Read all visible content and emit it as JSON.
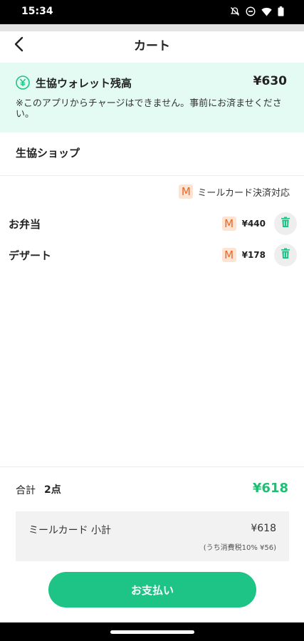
{
  "status_bar": {
    "time": "15:34",
    "icons": [
      "mute-icon",
      "do-not-disturb-icon",
      "wifi-icon",
      "battery-icon"
    ]
  },
  "header": {
    "back_icon": "chevron-left-icon",
    "title": "カート"
  },
  "wallet": {
    "icon": "yen-circle-icon",
    "title": "生協ウォレット残高",
    "balance": "¥630",
    "note": "※このアプリからチャージはできません。事前にお済ませください。"
  },
  "shop": {
    "name": "生協ショップ",
    "meal_card_badge": "M",
    "meal_card_legend": "ミールカード決済対応"
  },
  "items": [
    {
      "name": "お弁当",
      "badge": "M",
      "price": "¥440",
      "delete_icon": "trash-icon"
    },
    {
      "name": "デザート",
      "badge": "M",
      "price": "¥178",
      "delete_icon": "trash-icon"
    }
  ],
  "summary": {
    "total_label": "合計",
    "count": "2点",
    "total": "¥618",
    "subtotal_label": "ミールカード 小計",
    "subtotal_amount": "¥618",
    "tax_note": "(うち消費税10% ¥56)"
  },
  "pay_button_label": "お支払い",
  "colors": {
    "accent": "#1dc486",
    "total_green": "#1dbf73",
    "banner_bg": "#e3fbf2",
    "meal_badge_bg": "#fde3d2",
    "meal_badge_fg": "#f0641e"
  }
}
